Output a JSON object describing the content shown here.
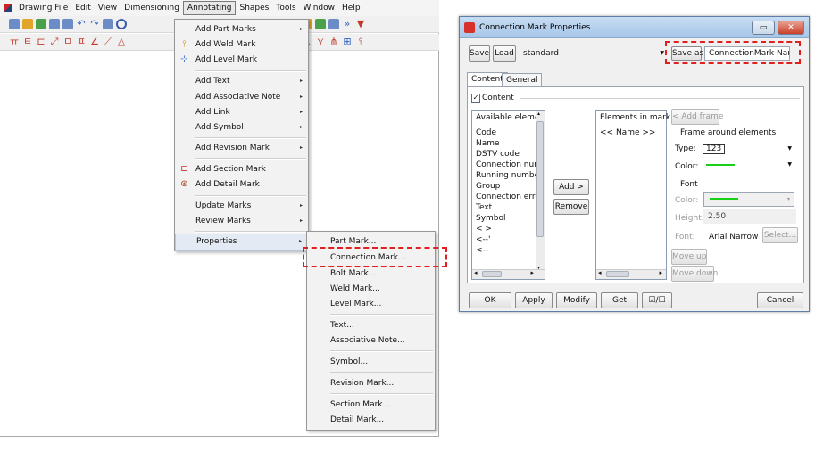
{
  "app": {
    "menu": [
      "Drawing File",
      "Edit",
      "View",
      "Dimensioning",
      "Annotating",
      "Shapes",
      "Tools",
      "Window",
      "Help"
    ],
    "open_menu": "Annotating"
  },
  "annotating_menu": {
    "items": [
      "Add Part Marks",
      "Add Weld Mark",
      "Add Level Mark",
      "Add Text",
      "Add Associative Note",
      "Add Link",
      "Add Symbol",
      "Add Revision Mark",
      "Add Section Mark",
      "Add Detail Mark",
      "Update Marks",
      "Review Marks",
      "Properties"
    ],
    "submenu_arrow": "▸"
  },
  "properties_submenu": {
    "items": [
      "Part Mark...",
      "Connection Mark...",
      "Bolt Mark...",
      "Weld Mark...",
      "Level Mark...",
      "Text...",
      "Associative Note...",
      "Symbol...",
      "Revision Mark...",
      "Section Mark...",
      "Detail Mark..."
    ]
  },
  "dialog": {
    "title": "Connection Mark Properties",
    "save_label": "Save",
    "load_label": "Load",
    "preset": "standard",
    "save_as_label": "Save as",
    "save_as_value": "ConnectionMark Name",
    "tabs": [
      "Content",
      "General"
    ],
    "content_checkbox_label": "Content",
    "available_header": "Available elemer",
    "available_items": [
      "Code",
      "Name",
      "DSTV code",
      "Connection num",
      "Running numbe",
      "Group",
      "Connection erro",
      "Text",
      "Symbol",
      "< >",
      "<--'",
      "<--"
    ],
    "in_mark_header": "Elements in mark",
    "in_mark_items": [
      "<< Name >>"
    ],
    "add_label": "Add >",
    "remove_label": "Remove",
    "add_frame_label": "< Add frame",
    "frame_group_label": "Frame around elements",
    "type_label": "Type:",
    "type_value": "123",
    "color_label": "Color:",
    "font_group_label": "Font",
    "font_color_label": "Color:",
    "height_label": "Height:",
    "height_value": "2.50",
    "font_label": "Font:",
    "font_value": "Arial Narrow",
    "select_label": "Select...",
    "move_up_label": "Move up",
    "move_down_label": "Move down",
    "ok_label": "OK",
    "apply_label": "Apply",
    "modify_label": "Modify",
    "get_label": "Get",
    "toggle_label": "☑/☐",
    "cancel_label": "Cancel",
    "frame_color": "#19d019",
    "checkbox_mark": "✓",
    "scroll_left": "◂",
    "scroll_right": "▸",
    "scroll_up": "▴",
    "scroll_down": "▾",
    "dropdown_arrow": "▼",
    "minimize_glyph": "▭",
    "close_glyph": "✕"
  }
}
